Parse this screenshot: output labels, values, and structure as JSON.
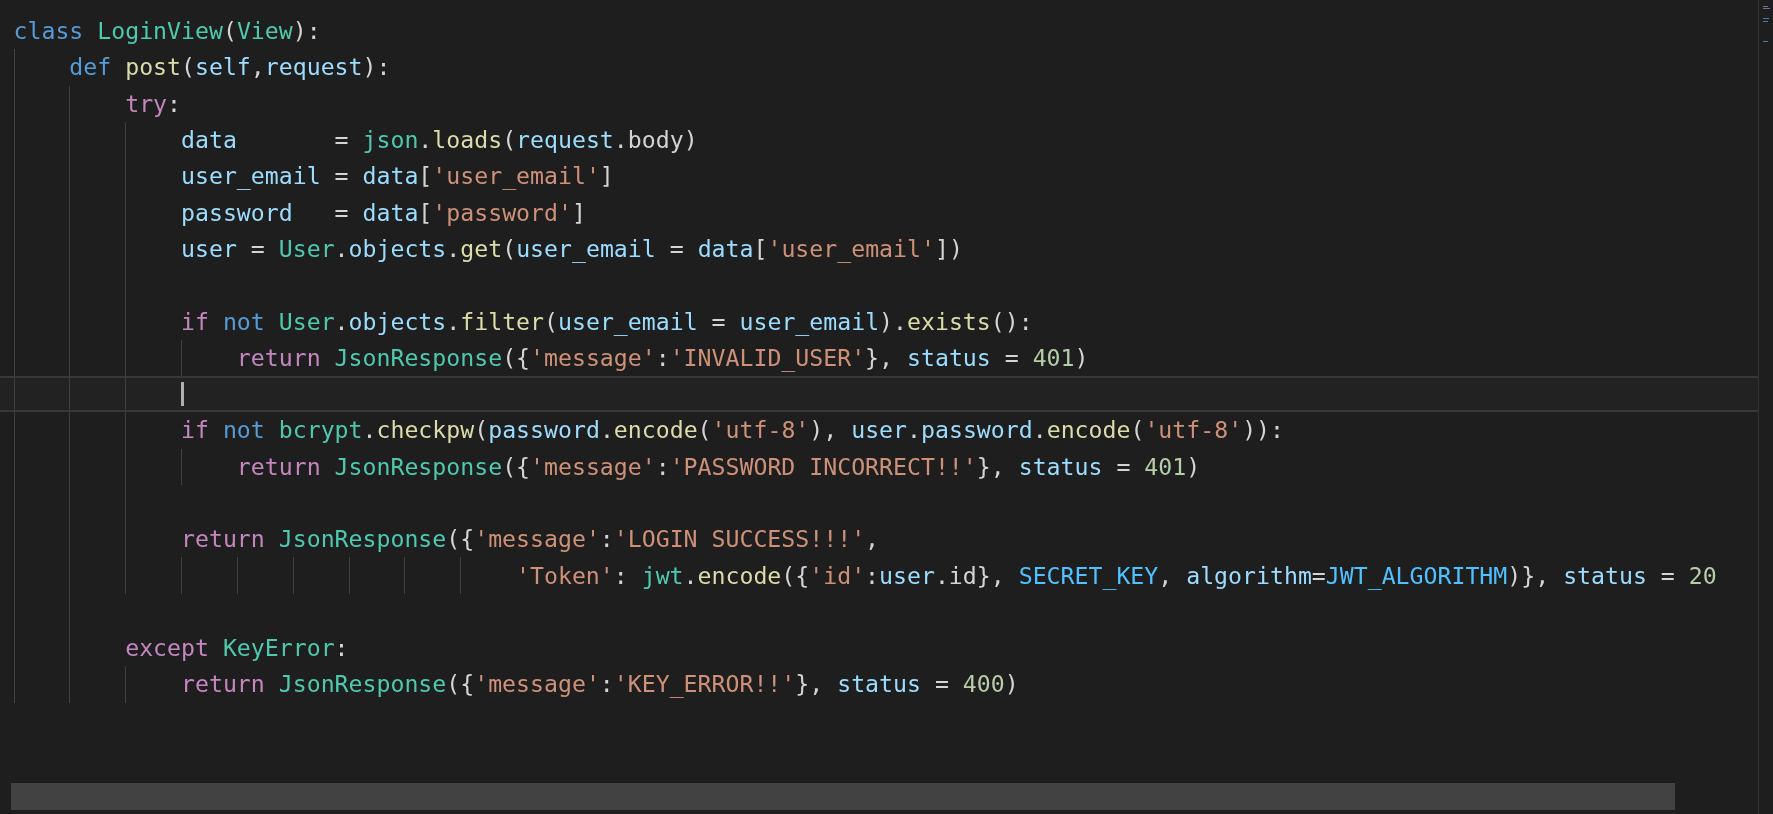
{
  "editor": {
    "lines": [
      {
        "kind": "code",
        "current": false,
        "tokens": [
          {
            "kind": "kw",
            "text": "class "
          },
          {
            "kind": "cls",
            "text": "LoginView"
          },
          {
            "kind": "pl",
            "text": "("
          },
          {
            "kind": "cls",
            "text": "View"
          },
          {
            "kind": "pl",
            "text": "):"
          }
        ],
        "children": [
          {
            "kind": "code",
            "current": false,
            "tokens": [
              {
                "kind": "kw",
                "text": "def "
              },
              {
                "kind": "fn",
                "text": "post"
              },
              {
                "kind": "pl",
                "text": "("
              },
              {
                "kind": "var",
                "text": "self"
              },
              {
                "kind": "pl",
                "text": ","
              },
              {
                "kind": "var",
                "text": "request"
              },
              {
                "kind": "pl",
                "text": "):"
              }
            ],
            "children": [
              {
                "kind": "code",
                "current": false,
                "tokens": [
                  {
                    "kind": "ctl",
                    "text": "try"
                  },
                  {
                    "kind": "pl",
                    "text": ":"
                  }
                ],
                "children": [
                  {
                    "kind": "code",
                    "current": false,
                    "tokens": [
                      {
                        "kind": "var",
                        "text": "data"
                      },
                      {
                        "kind": "pl",
                        "text": "       = "
                      },
                      {
                        "kind": "cls",
                        "text": "json"
                      },
                      {
                        "kind": "pl",
                        "text": "."
                      },
                      {
                        "kind": "fn",
                        "text": "loads"
                      },
                      {
                        "kind": "pl",
                        "text": "("
                      },
                      {
                        "kind": "var",
                        "text": "request"
                      },
                      {
                        "kind": "pl",
                        "text": ".body)"
                      }
                    ]
                  },
                  {
                    "kind": "code",
                    "current": false,
                    "tokens": [
                      {
                        "kind": "var",
                        "text": "user_email"
                      },
                      {
                        "kind": "pl",
                        "text": " = "
                      },
                      {
                        "kind": "var",
                        "text": "data"
                      },
                      {
                        "kind": "pl",
                        "text": "["
                      },
                      {
                        "kind": "str",
                        "text": "'user_email'"
                      },
                      {
                        "kind": "pl",
                        "text": "]"
                      }
                    ]
                  },
                  {
                    "kind": "code",
                    "current": false,
                    "tokens": [
                      {
                        "kind": "var",
                        "text": "password"
                      },
                      {
                        "kind": "pl",
                        "text": "   = "
                      },
                      {
                        "kind": "var",
                        "text": "data"
                      },
                      {
                        "kind": "pl",
                        "text": "["
                      },
                      {
                        "kind": "str",
                        "text": "'password'"
                      },
                      {
                        "kind": "pl",
                        "text": "]"
                      }
                    ]
                  },
                  {
                    "kind": "code",
                    "current": false,
                    "tokens": [
                      {
                        "kind": "var",
                        "text": "user"
                      },
                      {
                        "kind": "pl",
                        "text": " = "
                      },
                      {
                        "kind": "cls",
                        "text": "User"
                      },
                      {
                        "kind": "pl",
                        "text": "."
                      },
                      {
                        "kind": "var",
                        "text": "objects"
                      },
                      {
                        "kind": "pl",
                        "text": "."
                      },
                      {
                        "kind": "fn",
                        "text": "get"
                      },
                      {
                        "kind": "pl",
                        "text": "("
                      },
                      {
                        "kind": "var",
                        "text": "user_email"
                      },
                      {
                        "kind": "pl",
                        "text": " = "
                      },
                      {
                        "kind": "var",
                        "text": "data"
                      },
                      {
                        "kind": "pl",
                        "text": "["
                      },
                      {
                        "kind": "str",
                        "text": "'user_email'"
                      },
                      {
                        "kind": "pl",
                        "text": "])"
                      }
                    ]
                  },
                  {
                    "kind": "blank",
                    "current": false
                  },
                  {
                    "kind": "code",
                    "current": false,
                    "tokens": [
                      {
                        "kind": "ctl",
                        "text": "if "
                      },
                      {
                        "kind": "kw",
                        "text": "not "
                      },
                      {
                        "kind": "cls",
                        "text": "User"
                      },
                      {
                        "kind": "pl",
                        "text": "."
                      },
                      {
                        "kind": "var",
                        "text": "objects"
                      },
                      {
                        "kind": "pl",
                        "text": "."
                      },
                      {
                        "kind": "fn",
                        "text": "filter"
                      },
                      {
                        "kind": "pl",
                        "text": "("
                      },
                      {
                        "kind": "var",
                        "text": "user_email"
                      },
                      {
                        "kind": "pl",
                        "text": " = "
                      },
                      {
                        "kind": "var",
                        "text": "user_email"
                      },
                      {
                        "kind": "pl",
                        "text": ")."
                      },
                      {
                        "kind": "fn",
                        "text": "exists"
                      },
                      {
                        "kind": "pl",
                        "text": "():"
                      }
                    ],
                    "children": [
                      {
                        "kind": "code",
                        "current": false,
                        "tokens": [
                          {
                            "kind": "ctl",
                            "text": "return "
                          },
                          {
                            "kind": "cls",
                            "text": "JsonResponse"
                          },
                          {
                            "kind": "pl",
                            "text": "({"
                          },
                          {
                            "kind": "str",
                            "text": "'message'"
                          },
                          {
                            "kind": "pl",
                            "text": ":"
                          },
                          {
                            "kind": "str",
                            "text": "'INVALID_USER'"
                          },
                          {
                            "kind": "pl",
                            "text": "}, "
                          },
                          {
                            "kind": "var",
                            "text": "status"
                          },
                          {
                            "kind": "pl",
                            "text": " = "
                          },
                          {
                            "kind": "num",
                            "text": "401"
                          },
                          {
                            "kind": "pl",
                            "text": ")"
                          }
                        ]
                      }
                    ]
                  },
                  {
                    "kind": "blank",
                    "current": true
                  },
                  {
                    "kind": "code",
                    "current": false,
                    "tokens": [
                      {
                        "kind": "ctl",
                        "text": "if "
                      },
                      {
                        "kind": "kw",
                        "text": "not "
                      },
                      {
                        "kind": "cls",
                        "text": "bcrypt"
                      },
                      {
                        "kind": "pl",
                        "text": "."
                      },
                      {
                        "kind": "fn",
                        "text": "checkpw"
                      },
                      {
                        "kind": "pl",
                        "text": "("
                      },
                      {
                        "kind": "var",
                        "text": "password"
                      },
                      {
                        "kind": "pl",
                        "text": "."
                      },
                      {
                        "kind": "fn",
                        "text": "encode"
                      },
                      {
                        "kind": "pl",
                        "text": "("
                      },
                      {
                        "kind": "str",
                        "text": "'utf-8'"
                      },
                      {
                        "kind": "pl",
                        "text": "), "
                      },
                      {
                        "kind": "var",
                        "text": "user"
                      },
                      {
                        "kind": "pl",
                        "text": "."
                      },
                      {
                        "kind": "var",
                        "text": "password"
                      },
                      {
                        "kind": "pl",
                        "text": "."
                      },
                      {
                        "kind": "fn",
                        "text": "encode"
                      },
                      {
                        "kind": "pl",
                        "text": "("
                      },
                      {
                        "kind": "str",
                        "text": "'utf-8'"
                      },
                      {
                        "kind": "pl",
                        "text": ")):"
                      }
                    ],
                    "children": [
                      {
                        "kind": "code",
                        "current": false,
                        "tokens": [
                          {
                            "kind": "ctl",
                            "text": "return "
                          },
                          {
                            "kind": "cls",
                            "text": "JsonResponse"
                          },
                          {
                            "kind": "pl",
                            "text": "({"
                          },
                          {
                            "kind": "str",
                            "text": "'message'"
                          },
                          {
                            "kind": "pl",
                            "text": ":"
                          },
                          {
                            "kind": "str",
                            "text": "'PASSWORD INCORRECT!!'"
                          },
                          {
                            "kind": "pl",
                            "text": "}, "
                          },
                          {
                            "kind": "var",
                            "text": "status"
                          },
                          {
                            "kind": "pl",
                            "text": " = "
                          },
                          {
                            "kind": "num",
                            "text": "401"
                          },
                          {
                            "kind": "pl",
                            "text": ")"
                          }
                        ]
                      }
                    ]
                  },
                  {
                    "kind": "blank",
                    "current": false
                  },
                  {
                    "kind": "code",
                    "current": false,
                    "tokens": [
                      {
                        "kind": "ctl",
                        "text": "return "
                      },
                      {
                        "kind": "cls",
                        "text": "JsonResponse"
                      },
                      {
                        "kind": "pl",
                        "text": "({"
                      },
                      {
                        "kind": "str",
                        "text": "'message'"
                      },
                      {
                        "kind": "pl",
                        "text": ":"
                      },
                      {
                        "kind": "str",
                        "text": "'LOGIN SUCCESS!!!'"
                      },
                      {
                        "kind": "pl",
                        "text": ","
                      }
                    ],
                    "children": [
                      {
                        "kind": "continuation",
                        "current": false,
                        "tokens": [
                          {
                            "kind": "str",
                            "text": "'Token'"
                          },
                          {
                            "kind": "pl",
                            "text": ": "
                          },
                          {
                            "kind": "cls",
                            "text": "jwt"
                          },
                          {
                            "kind": "pl",
                            "text": "."
                          },
                          {
                            "kind": "fn",
                            "text": "encode"
                          },
                          {
                            "kind": "pl",
                            "text": "({"
                          },
                          {
                            "kind": "str",
                            "text": "'id'"
                          },
                          {
                            "kind": "pl",
                            "text": ":"
                          },
                          {
                            "kind": "var",
                            "text": "user"
                          },
                          {
                            "kind": "pl",
                            "text": ".id}, "
                          },
                          {
                            "kind": "const",
                            "text": "SECRET_KEY"
                          },
                          {
                            "kind": "pl",
                            "text": ", "
                          },
                          {
                            "kind": "var",
                            "text": "algorithm"
                          },
                          {
                            "kind": "pl",
                            "text": "="
                          },
                          {
                            "kind": "const",
                            "text": "JWT_ALGORITHM"
                          },
                          {
                            "kind": "pl",
                            "text": ")}, "
                          },
                          {
                            "kind": "var",
                            "text": "status"
                          },
                          {
                            "kind": "pl",
                            "text": " = "
                          },
                          {
                            "kind": "num",
                            "text": "20"
                          }
                        ]
                      }
                    ]
                  }
                ]
              },
              {
                "kind": "blank",
                "current": false
              },
              {
                "kind": "code",
                "current": false,
                "tokens": [
                  {
                    "kind": "ctl",
                    "text": "except "
                  },
                  {
                    "kind": "cls",
                    "text": "KeyError"
                  },
                  {
                    "kind": "pl",
                    "text": ":"
                  }
                ],
                "children": [
                  {
                    "kind": "code",
                    "current": false,
                    "tokens": [
                      {
                        "kind": "ctl",
                        "text": "return "
                      },
                      {
                        "kind": "cls",
                        "text": "JsonResponse"
                      },
                      {
                        "kind": "pl",
                        "text": "({"
                      },
                      {
                        "kind": "str",
                        "text": "'message'"
                      },
                      {
                        "kind": "pl",
                        "text": ":"
                      },
                      {
                        "kind": "str",
                        "text": "'KEY_ERROR!!'"
                      },
                      {
                        "kind": "pl",
                        "text": "}, "
                      },
                      {
                        "kind": "var",
                        "text": "status"
                      },
                      {
                        "kind": "pl",
                        "text": " = "
                      },
                      {
                        "kind": "num",
                        "text": "400"
                      },
                      {
                        "kind": "pl",
                        "text": ")"
                      }
                    ]
                  }
                ]
              }
            ]
          }
        ]
      }
    ]
  }
}
